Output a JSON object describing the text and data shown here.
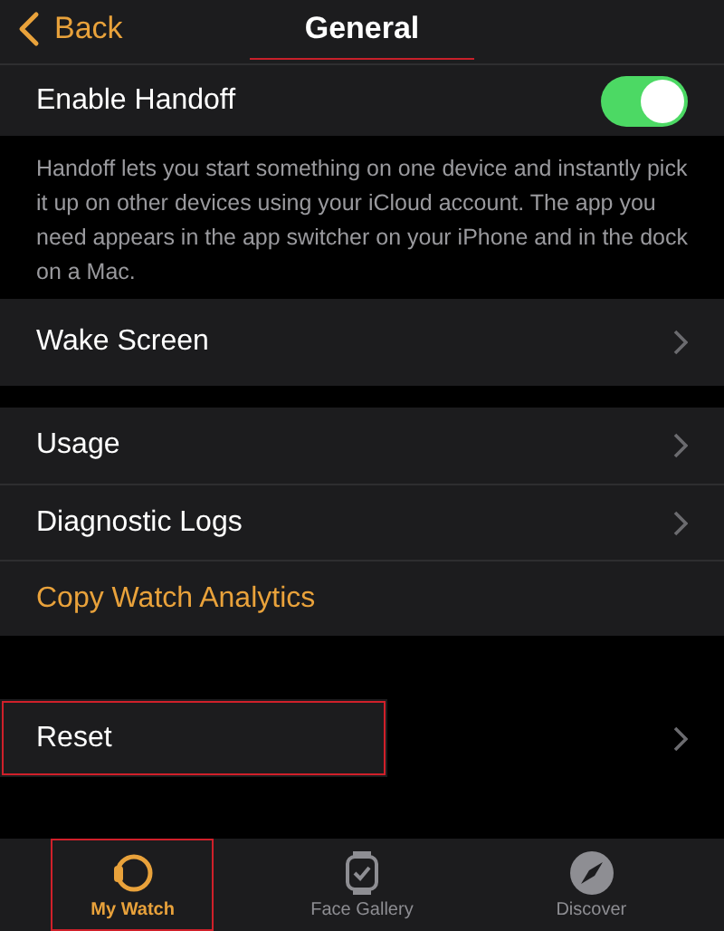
{
  "nav": {
    "back": "Back",
    "title": "General",
    "title_highlighted": true
  },
  "handoff": {
    "label": "Enable Handoff",
    "on": true,
    "description": "Handoff lets you start something on one device and instantly pick it up on other devices using your iCloud account. The app you need appears in the app switcher on your iPhone and in the dock on a Mac."
  },
  "groups": [
    {
      "rows": [
        {
          "kind": "link",
          "label": "Wake Screen",
          "highlighted": false
        }
      ]
    },
    {
      "rows": [
        {
          "kind": "link",
          "label": "Usage",
          "highlighted": false
        },
        {
          "kind": "link",
          "label": "Diagnostic Logs",
          "highlighted": false
        },
        {
          "kind": "action",
          "label": "Copy Watch Analytics",
          "highlighted": false
        }
      ]
    },
    {
      "rows": [
        {
          "kind": "link",
          "label": "Reset",
          "highlighted": true
        }
      ]
    }
  ],
  "tabs": [
    {
      "kind": "watch",
      "label": "My Watch",
      "selected": true,
      "highlighted": true
    },
    {
      "kind": "face",
      "label": "Face Gallery",
      "selected": false,
      "highlighted": false
    },
    {
      "kind": "compass",
      "label": "Discover",
      "selected": false,
      "highlighted": false
    }
  ]
}
